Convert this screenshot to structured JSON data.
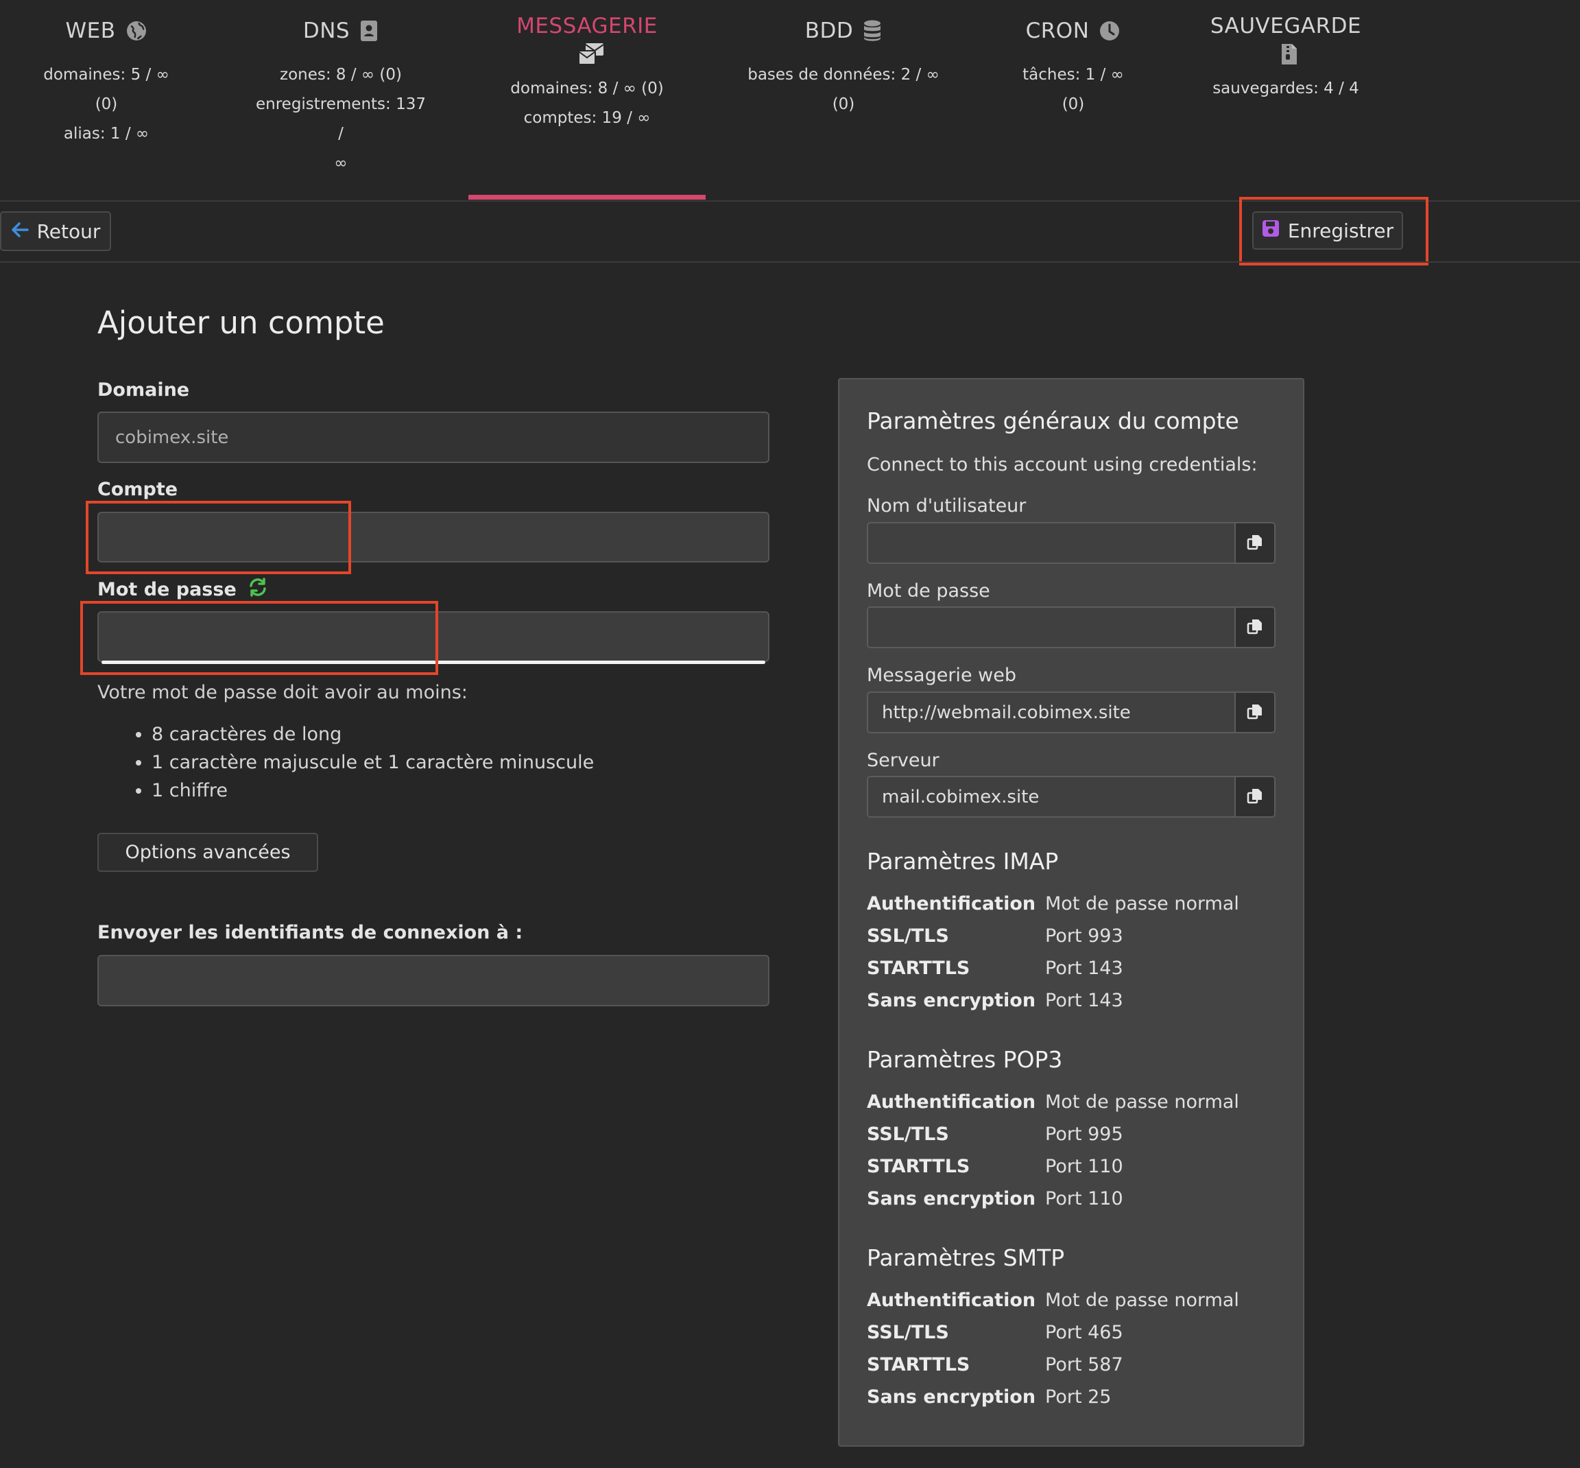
{
  "nav": {
    "tabs": [
      {
        "title": "WEB",
        "icon": "globe-icon",
        "stats": [
          "domaines: 5 / ∞",
          "(0)",
          "alias: 1 / ∞"
        ]
      },
      {
        "title": "DNS",
        "icon": "address-book-icon",
        "stats": [
          "zones: 8 / ∞ (0)",
          "enregistrements: 137 /",
          "∞"
        ]
      },
      {
        "title": "MESSAGERIE",
        "icon": "mail-bulk-icon",
        "active": true,
        "stats": [
          "domaines: 8 / ∞ (0)",
          "comptes: 19 / ∞"
        ]
      },
      {
        "title": "BDD",
        "icon": "database-icon",
        "stats": [
          "bases de données: 2 / ∞",
          "(0)"
        ]
      },
      {
        "title": "CRON",
        "icon": "clock-icon",
        "stats": [
          "tâches: 1 / ∞",
          "(0)"
        ]
      },
      {
        "title": "SAUVEGARDE",
        "icon": "file-archive-icon",
        "stats": [
          "sauvegardes: 4 / 4"
        ]
      }
    ],
    "active_color": "#d4476f"
  },
  "toolbar": {
    "back_label": "Retour",
    "save_label": "Enregistrer"
  },
  "form": {
    "title": "Ajouter un compte",
    "domain_label": "Domaine",
    "domain_value": "cobimex.site",
    "account_label": "Compte",
    "account_value": "",
    "password_label": "Mot de passe",
    "password_value": "",
    "password_hint": "Votre mot de passe doit avoir au moins:",
    "password_rules": [
      "8 caractères de long",
      "1 caractère majuscule et 1 caractère minuscule",
      "1 chiffre"
    ],
    "advanced_label": "Options avancées",
    "send_label": "Envoyer les identifiants de connexion à :",
    "send_value": ""
  },
  "settings": {
    "title": "Paramètres généraux du compte",
    "intro": "Connect to this account using credentials:",
    "fields": [
      {
        "label": "Nom d'utilisateur",
        "value": ""
      },
      {
        "label": "Mot de passe",
        "value": ""
      },
      {
        "label": "Messagerie web",
        "value": "http://webmail.cobimex.site"
      },
      {
        "label": "Serveur",
        "value": "mail.cobimex.site"
      }
    ],
    "imap": {
      "title": "Paramètres IMAP",
      "rows": [
        {
          "key": "Authentification",
          "value": "Mot de passe normal"
        },
        {
          "key": "SSL/TLS",
          "value": "Port 993"
        },
        {
          "key": "STARTTLS",
          "value": "Port 143"
        },
        {
          "key": "Sans encryption",
          "value": "Port 143"
        }
      ]
    },
    "pop3": {
      "title": "Paramètres POP3",
      "rows": [
        {
          "key": "Authentification",
          "value": "Mot de passe normal"
        },
        {
          "key": "SSL/TLS",
          "value": "Port 995"
        },
        {
          "key": "STARTTLS",
          "value": "Port 110"
        },
        {
          "key": "Sans encryption",
          "value": "Port 110"
        }
      ]
    },
    "smtp": {
      "title": "Paramètres SMTP",
      "rows": [
        {
          "key": "Authentification",
          "value": "Mot de passe normal"
        },
        {
          "key": "SSL/TLS",
          "value": "Port 465"
        },
        {
          "key": "STARTTLS",
          "value": "Port 587"
        },
        {
          "key": "Sans encryption",
          "value": "Port 25"
        }
      ]
    }
  }
}
